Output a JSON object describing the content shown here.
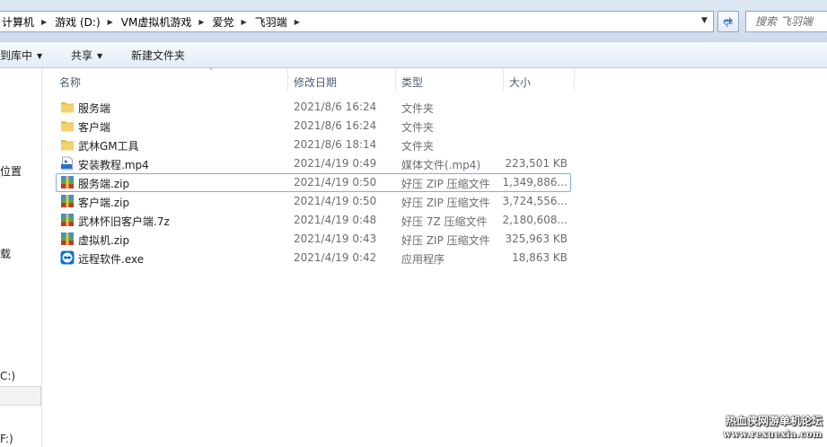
{
  "address_bar": {
    "breadcrumbs": [
      "计算机",
      "游戏 (D:)",
      "VM虚拟机游戏",
      "爱党",
      "飞羽端"
    ]
  },
  "search": {
    "placeholder": "搜索 飞羽端"
  },
  "toolbar": {
    "include_label": "到库中",
    "share_label": "共享",
    "new_folder_label": "新建文件夹"
  },
  "nav": {
    "items": [
      "位置",
      "载",
      "C:)",
      "F:)"
    ]
  },
  "columns": {
    "name": "名称",
    "date": "修改日期",
    "type": "类型",
    "size": "大小"
  },
  "files": [
    {
      "name": "服务端",
      "date": "2021/8/6 16:24",
      "type": "文件夹",
      "size": "",
      "icon": "folder-icon"
    },
    {
      "name": "客户端",
      "date": "2021/8/6 16:24",
      "type": "文件夹",
      "size": "",
      "icon": "folder-icon"
    },
    {
      "name": "武林GM工具",
      "date": "2021/8/6 18:14",
      "type": "文件夹",
      "size": "",
      "icon": "folder-icon"
    },
    {
      "name": "安装教程.mp4",
      "date": "2021/4/19 0:49",
      "type": "媒体文件(.mp4)",
      "size": "223,501 KB",
      "icon": "mp4-file-icon"
    },
    {
      "name": "服务端.zip",
      "date": "2021/4/19 0:50",
      "type": "好压 ZIP 压缩文件",
      "size": "1,349,886...",
      "icon": "archive-icon"
    },
    {
      "name": "客户端.zip",
      "date": "2021/4/19 0:50",
      "type": "好压 ZIP 压缩文件",
      "size": "3,724,556...",
      "icon": "archive-icon"
    },
    {
      "name": "武林怀旧客户端.7z",
      "date": "2021/4/19 0:48",
      "type": "好压 7Z 压缩文件",
      "size": "2,180,608...",
      "icon": "archive-icon"
    },
    {
      "name": "虚拟机.zip",
      "date": "2021/4/19 0:43",
      "type": "好压 ZIP 压缩文件",
      "size": "325,963 KB",
      "icon": "archive-icon"
    },
    {
      "name": "远程软件.exe",
      "date": "2021/4/19 0:42",
      "type": "应用程序",
      "size": "18,863 KB",
      "icon": "teamviewer-icon"
    }
  ],
  "watermark": {
    "title": "热血侠网游单机论坛",
    "url": "www.rexuexia.com"
  }
}
